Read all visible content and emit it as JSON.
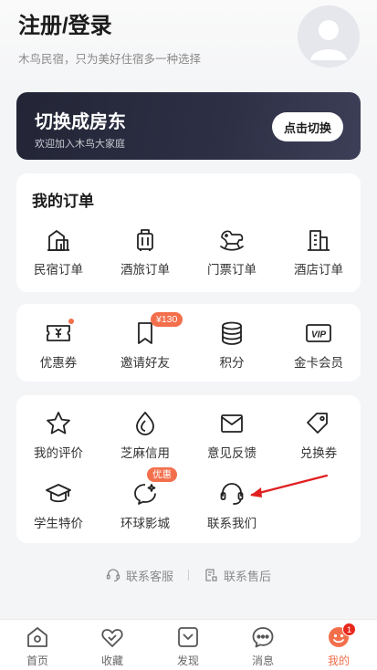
{
  "header": {
    "title": "注册/登录",
    "subtitle": "木鸟民宿，只为美好住宿多一种选择"
  },
  "banner": {
    "title": "切换成房东",
    "subtitle": "欢迎加入木鸟大家庭",
    "button_label": "点击切换"
  },
  "orders": {
    "title": "我的订单",
    "items": [
      {
        "label": "民宿订单",
        "icon": "house-icon"
      },
      {
        "label": "酒旅订单",
        "icon": "luggage-icon"
      },
      {
        "label": "门票订单",
        "icon": "rocking-horse-icon"
      },
      {
        "label": "酒店订单",
        "icon": "hotel-building-icon"
      }
    ]
  },
  "benefits": {
    "items": [
      {
        "label": "优惠券",
        "icon": "ticket-icon"
      },
      {
        "label": "邀请好友",
        "icon": "bookmark-icon",
        "badge": "¥130"
      },
      {
        "label": "积分",
        "icon": "coins-icon"
      },
      {
        "label": "金卡会员",
        "icon": "vip-card-icon",
        "icon_text": "VIP"
      }
    ]
  },
  "services": {
    "items": [
      {
        "label": "我的评价",
        "icon": "star-icon"
      },
      {
        "label": "芝麻信用",
        "icon": "sesame-credit-icon"
      },
      {
        "label": "意见反馈",
        "icon": "mail-icon"
      },
      {
        "label": "兑换券",
        "icon": "tag-icon"
      },
      {
        "label": "学生特价",
        "icon": "graduation-cap-icon"
      },
      {
        "label": "环球影城",
        "icon": "globe-chat-icon",
        "badge": "优惠"
      },
      {
        "label": "联系我们",
        "icon": "headset-icon"
      }
    ]
  },
  "support": {
    "service_label": "联系客服",
    "aftersale_label": "联系售后"
  },
  "tabbar": {
    "items": [
      {
        "label": "首页",
        "icon": "home-icon"
      },
      {
        "label": "收藏",
        "icon": "heart-icon"
      },
      {
        "label": "发现",
        "icon": "discover-icon"
      },
      {
        "label": "消息",
        "icon": "message-icon"
      },
      {
        "label": "我的",
        "icon": "profile-icon",
        "active": true,
        "badge": "1"
      }
    ]
  },
  "colors": {
    "accent": "#f36f4c",
    "banner_bg": "#2a2c40",
    "badge_red": "#e8271b",
    "arrow_red": "#e02020"
  }
}
